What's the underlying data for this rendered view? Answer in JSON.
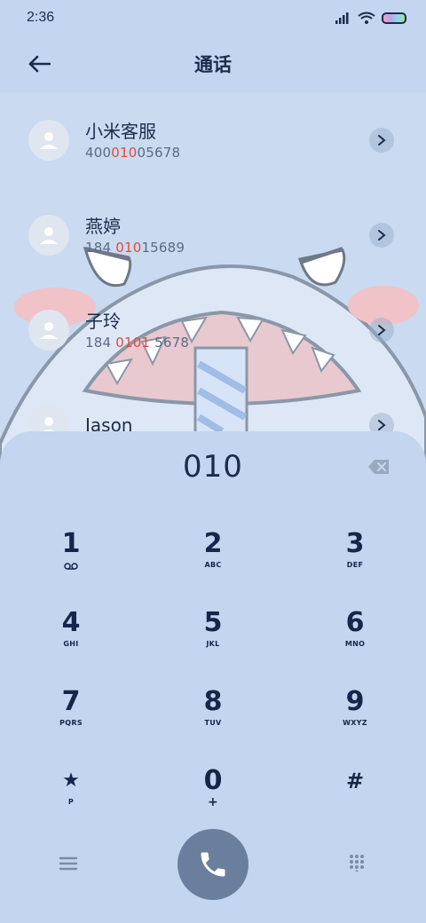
{
  "status_bar": {
    "time": "2:36"
  },
  "header": {
    "title": "通话"
  },
  "contacts": [
    {
      "name": "小米客服",
      "number_pre": "400",
      "number_match": "010",
      "number_post": "05678"
    },
    {
      "name": "燕婷",
      "number_pre": "184 ",
      "number_match": "010",
      "number_post": "15689"
    },
    {
      "name": "子玲",
      "number_pre": "184 ",
      "number_match": "0101",
      "number_post": " 5678"
    },
    {
      "name": "Jason",
      "number_pre": "",
      "number_match": "",
      "number_post": ""
    }
  ],
  "dialer": {
    "display": "010",
    "keys": [
      {
        "digit": "1",
        "sub": "voicemail-icon"
      },
      {
        "digit": "2",
        "sub": "ABC"
      },
      {
        "digit": "3",
        "sub": "DEF"
      },
      {
        "digit": "4",
        "sub": "GHI"
      },
      {
        "digit": "5",
        "sub": "JKL"
      },
      {
        "digit": "6",
        "sub": "MNO"
      },
      {
        "digit": "7",
        "sub": "PQRS"
      },
      {
        "digit": "8",
        "sub": "TUV"
      },
      {
        "digit": "9",
        "sub": "WXYZ"
      },
      {
        "digit": "★",
        "sub": "P"
      },
      {
        "digit": "0",
        "sub": "+"
      },
      {
        "digit": "#",
        "sub": ""
      }
    ]
  },
  "colors": {
    "background": "#c3d5ef",
    "text": "#1c2b4a",
    "highlight": "#e24b3b",
    "call_button": "#6a7f9e"
  }
}
